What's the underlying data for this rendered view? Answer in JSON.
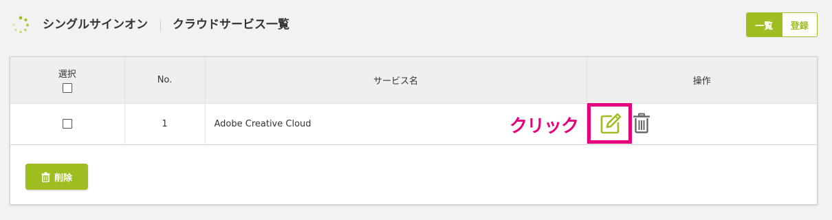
{
  "header": {
    "app_title": "シングルサインオン",
    "page_title": "クラウドサービス一覧",
    "view_toggle": {
      "list_label": "一覧",
      "register_label": "登録"
    }
  },
  "table": {
    "columns": {
      "select": "選択",
      "no": "No.",
      "service_name": "サービス名",
      "actions": "操作"
    },
    "rows": [
      {
        "no": "1",
        "service_name": "Adobe Creative Cloud"
      }
    ]
  },
  "annotation": {
    "click_label": "クリック"
  },
  "footer": {
    "delete_label": "削除"
  },
  "icons": {
    "logo": "spinner-dots-icon",
    "edit": "edit-pencil-icon",
    "trash": "trash-icon",
    "delete_button": "trash-icon"
  },
  "colors": {
    "accent": "#9ebd21",
    "annotation": "#e6007e",
    "header_bg": "#efefef"
  }
}
